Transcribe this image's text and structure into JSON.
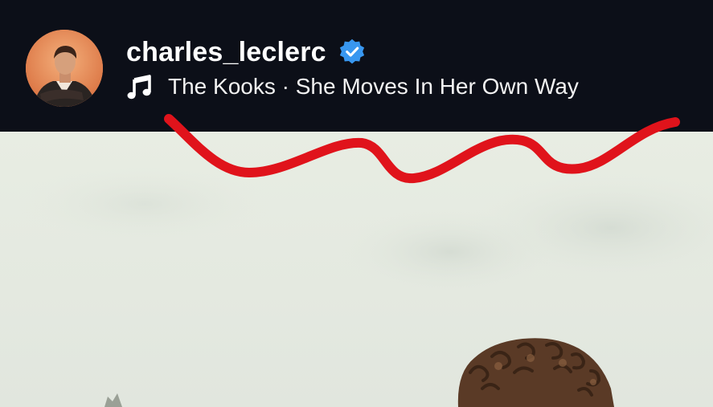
{
  "profile": {
    "username": "charles_leclerc",
    "verified": true,
    "avatar_icon": "avatar-photo"
  },
  "music": {
    "icon": "music-note-icon",
    "track": "The Kooks · She Moves In Her Own Way"
  },
  "colors": {
    "header_bg": "#0c0f18",
    "verified_blue": "#3897f0",
    "sky": "#e6ebe2",
    "annotation_red": "#e0131b"
  }
}
